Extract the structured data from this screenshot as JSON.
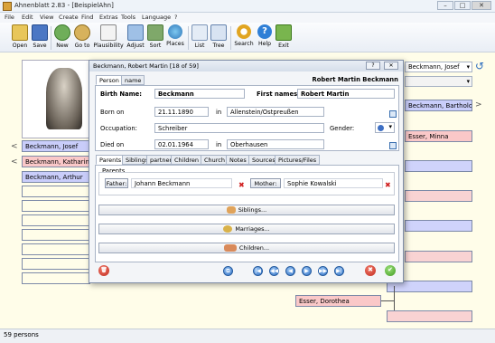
{
  "window": {
    "title": "Ahnenblatt 2.83 - [BeispielAhn]",
    "minimize": "–",
    "maximize": "□",
    "close": "✕"
  },
  "menu": [
    "File",
    "Edit",
    "View",
    "Create",
    "Find",
    "Extras",
    "Tools",
    "Language",
    "?"
  ],
  "toolbar": {
    "open": "Open",
    "save": "Save",
    "new": "New",
    "goto": "Go to",
    "plausibility": "Plausibility",
    "adjust": "Adjust",
    "sort": "Sort",
    "places": "Places",
    "list": "List",
    "tree": "Tree",
    "search": "Search",
    "help": "Help",
    "exit": "Exit",
    "help_glyph": "?"
  },
  "tree": {
    "left_cards": [
      "Beckmann, Josef",
      "Beckmann, Katharina",
      "Beckmann, Arthur"
    ],
    "right_cards": [
      "Beckmann, Josef",
      "Beckmann, Bartholomäus",
      "Esser, Minna",
      "Esser, Dorothea"
    ],
    "left_arrow": "<",
    "right_arrow": ">",
    "dropdown_caret": "▾",
    "refresh_glyph": "↺"
  },
  "status": {
    "text": "59 persons"
  },
  "dialog": {
    "title": "Beckmann, Robert Martin [18 of 59]",
    "help_btn": "?",
    "close_btn": "✕",
    "tabs_top": [
      "Person",
      "name"
    ],
    "header_name": "Robert Martin Beckmann",
    "fields": {
      "birth_name_label": "Birth Name:",
      "birth_name": "Beckmann",
      "first_names_label": "First names:",
      "first_names": "Robert Martin",
      "born_on_label": "Born on",
      "born_on": "21.11.1890",
      "in_label": "in",
      "born_place": "Allenstein/Ostpreußen",
      "occupation_label": "Occupation:",
      "occupation": "Schreiber",
      "gender_label": "Gender:",
      "gender_caret": "▾",
      "died_on_label": "Died on",
      "died_on": "02.01.1964",
      "died_place": "Oberhausen"
    },
    "tabs_bottom": [
      "Parents",
      "Siblings",
      "partner",
      "Children",
      "Church",
      "Notes",
      "Sources",
      "Pictures/Files"
    ],
    "parents": {
      "group_label": "Parents",
      "father_label": "Father:",
      "father": "Johann Beckmann",
      "mother_label": "Mother:",
      "mother": "Sophie Kowalski",
      "remove_glyph": "✖"
    },
    "buttons": {
      "siblings": "Siblings...",
      "marriages": "Marriages...",
      "children": "Children..."
    },
    "nav": {
      "first": "|◀",
      "prev_fast": "◀◀",
      "prev": "◀",
      "next": "▶",
      "next_fast": "▶▶",
      "last": "▶|",
      "copy": "⧉",
      "cancel": "✖",
      "ok": "✔",
      "delete": "🗑"
    }
  }
}
